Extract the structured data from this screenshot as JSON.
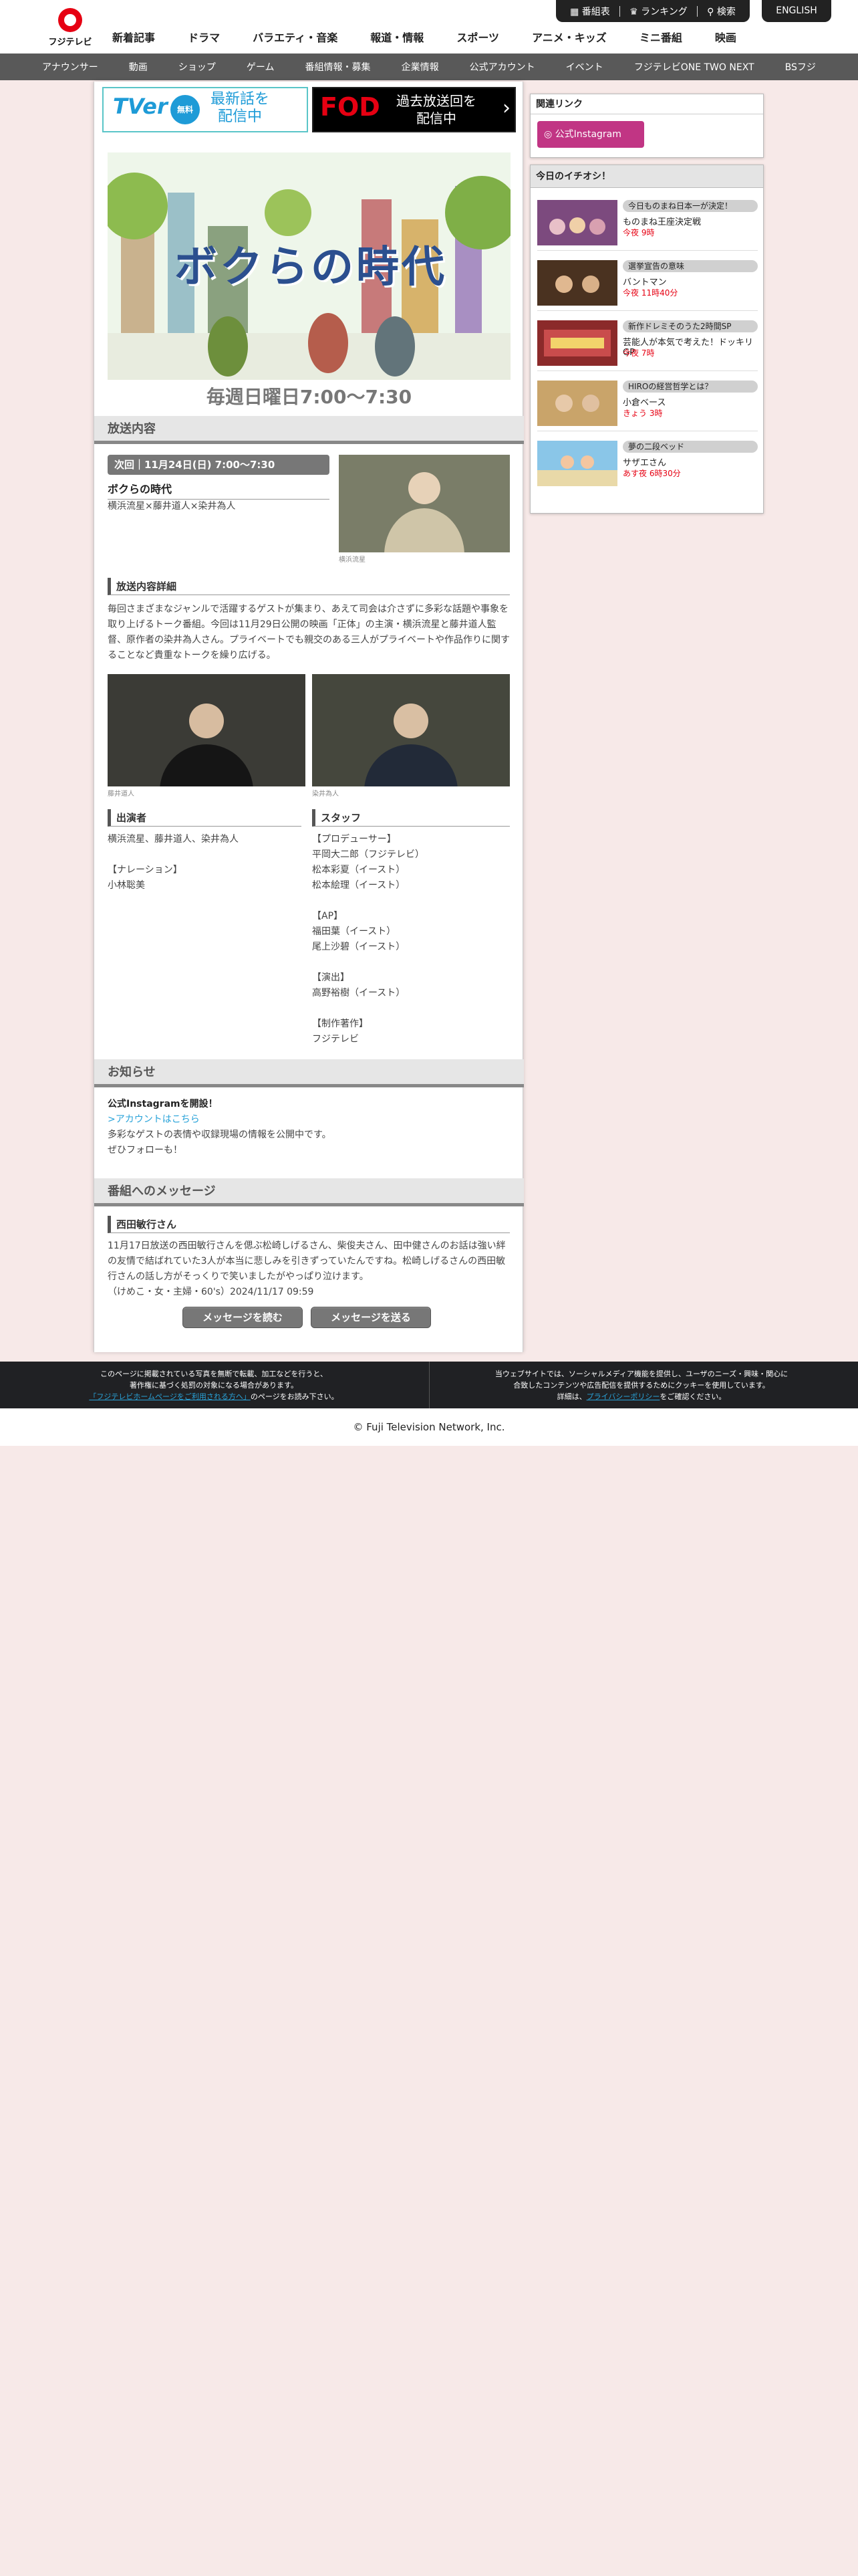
{
  "header": {
    "logo_text": "フジテレビ",
    "util_items": [
      "番組表",
      "ランキング",
      "検索"
    ],
    "english": "ENGLISH",
    "main_nav": [
      "新着記事",
      "ドラマ",
      "バラエティ・音楽",
      "報道・情報",
      "スポーツ",
      "アニメ・キッズ",
      "ミニ番組",
      "映画"
    ],
    "sub_nav": [
      "アナウンサー",
      "動画",
      "ショップ",
      "ゲーム",
      "番組情報・募集",
      "企業情報",
      "公式アカウント",
      "イベント",
      "フジテレビONE TWO NEXT",
      "BSフジ"
    ]
  },
  "banners": {
    "tver_logo": "TVer",
    "tver_badge": "無料",
    "tver_text": "最新話を\n配信中",
    "fod_logo": "FOD",
    "fod_text": "過去放送回を\n配信中"
  },
  "program": {
    "hero_title": "ボクらの時代",
    "airtime": "毎週日曜日7:00〜7:30"
  },
  "broadcast": {
    "section_title": "放送内容",
    "next_label": "次回｜11月24日(日) 7:00〜7:30",
    "episode_title": "ボクらの時代",
    "guests": "横浜流星×藤井道人×染井為人",
    "photo1_caption": "横浜流星",
    "detail_head": "放送内容詳細",
    "detail_text": "毎回さまざまなジャンルで活躍するゲストが集まり、あえて司会は介さずに多彩な話題や事象を取り上げるトーク番組。今回は11月29日公開の映画「正体」の主演・横浜流星と藤井道人監督、原作者の染井為人さん。プライベートでも親交のある三人がプライベートや作品作りに関することなど貴重なトークを繰り広げる。",
    "photo2_caption": "藤井道人",
    "photo3_caption": "染井為人",
    "cast_head": "出演者",
    "cast_text": "横浜流星、藤井道人、染井為人",
    "narration_label": "【ナレーション】",
    "narration_name": "小林聡美",
    "staff_head": "スタッフ",
    "staff_lines": [
      "【プロデューサー】",
      "平岡大二郎（フジテレビ）",
      "松本彩夏（イースト）",
      "松本絵理（イースト）",
      "",
      "【AP】",
      "福田葉（イースト）",
      "尾上沙碧（イースト）",
      "",
      "【演出】",
      "高野裕樹（イースト）",
      "",
      "【制作著作】",
      "フジテレビ"
    ]
  },
  "news": {
    "section_title": "お知らせ",
    "headline": "公式Instagramを開設！",
    "link_text": ">アカウントはこちら",
    "line1": "多彩なゲストの表情や収録現場の情報を公開中です。",
    "line2": "ぜひフォローも！"
  },
  "messages": {
    "section_title": "番組へのメッセージ",
    "author": "西田敏行さん",
    "body": "11月17日放送の西田敏行さんを偲ぶ松崎しげるさん、柴俊夫さん、田中健さんのお話は強い絆の友情で結ばれていた3人が本当に悲しみを引きずっていたんですね。松崎しげるさんの西田敏行さんの話し方がそっくりで笑いましたがやっぱり泣けます。",
    "meta": "（けめこ・女・主婦・60's）2024/11/17 09:59",
    "read_btn": "メッセージを読む",
    "send_btn": "メッセージを送る"
  },
  "sidebar": {
    "related_title": "関連リンク",
    "instagram_btn": "公式Instagram",
    "picks_title": "今日のイチオシ！",
    "picks": [
      {
        "badge": "今日ものまね日本一が決定！",
        "title": "ものまね王座決定戦",
        "time": "今夜 9時"
      },
      {
        "badge": "選挙宣告の意味",
        "title": "バントマン",
        "time": "今夜 11時40分"
      },
      {
        "badge": "新作ドレミそのうた2時間SP",
        "title": "芸能人が本気で考えた！ドッキリGP",
        "time": "今夜 7時"
      },
      {
        "badge": "HIROの経営哲学とは？",
        "title": "小倉ベース",
        "time": "きょう 3時"
      },
      {
        "badge": "夢の二段ベッド",
        "title": "サザエさん",
        "time": "あす夜 6時30分"
      }
    ]
  },
  "footer": {
    "left_lines": [
      "このページに掲載されている写真を無断で転載、加工などを行うと、",
      "著作権に基づく処罰の対象になる場合があります。"
    ],
    "left_link": "「フジテレビホームページをご利用される方へ」",
    "left_tail": "のページをお読み下さい。",
    "right_lines": [
      "当ウェブサイトでは、ソーシャルメディア機能を提供し、ユーザのニーズ・興味・関心に",
      "合致したコンテンツや広告配信を提供するためにクッキーを使用しています。"
    ],
    "right_pre": "詳細は、",
    "right_link": "プライバシーポリシー",
    "right_tail": "をご確認ください。",
    "copyright": "© Fuji Television Network, Inc."
  },
  "colors": {
    "accent_red": "#e60012",
    "instagram": "#c13584",
    "tver": "#1e9bd7",
    "fod": "#e60012"
  }
}
